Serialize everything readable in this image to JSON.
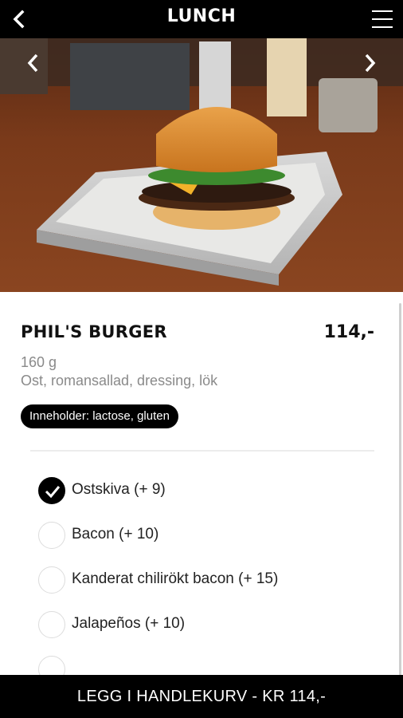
{
  "header": {
    "title": "LUNCH",
    "back_icon": "chevron-left-icon",
    "menu_icon": "hamburger-menu-icon"
  },
  "gallery": {
    "prev_icon": "chevron-left-icon",
    "next_icon": "chevron-right-icon",
    "image_alt": "burger-photo"
  },
  "product": {
    "name": "PHIL'S BURGER",
    "price": "114,-",
    "weight": "160 g",
    "description": "Ost, romansallad, dressing, lök",
    "allergens": "Inneholder: lactose, gluten"
  },
  "options": [
    {
      "label": "Ostskiva (+ 9)",
      "checked": true
    },
    {
      "label": "Bacon (+ 10)",
      "checked": false
    },
    {
      "label": "Kanderat chilirökt bacon (+ 15)",
      "checked": false
    },
    {
      "label": "Jalapeños (+ 10)",
      "checked": false
    }
  ],
  "footer": {
    "cart_button": "LEGG I HANDLEKURV - KR 114,-"
  },
  "colors": {
    "bar": "#000000",
    "text_muted": "#8a8a8a"
  }
}
